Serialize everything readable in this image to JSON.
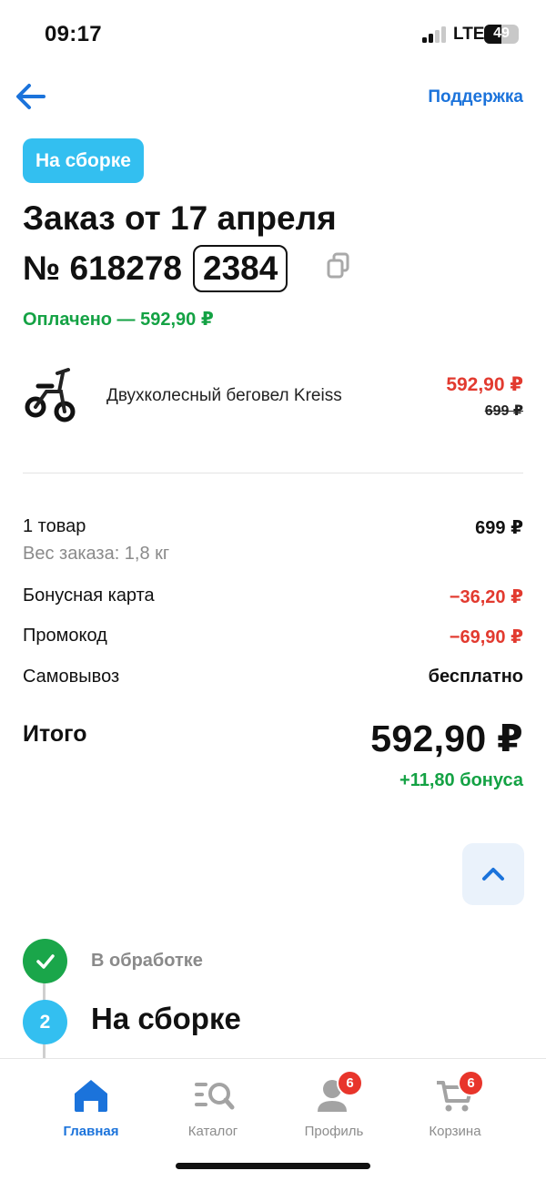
{
  "status_bar": {
    "time": "09:17",
    "network": "LTE",
    "battery": "49",
    "battery_level": 0.49
  },
  "header": {
    "support_label": "Поддержка"
  },
  "order": {
    "status_badge": "На сборке",
    "title": "Заказ от 17 апреля",
    "number_prefix": "№ 618278",
    "number_highlight": "2384",
    "paid_text": "Оплачено — 592,90 ₽"
  },
  "item": {
    "name": "Двухколесный беговел Kreiss",
    "price": "592,90 ₽",
    "old_price": "699 ₽"
  },
  "summary": {
    "items_count_label": "1 товар",
    "items_total": "699 ₽",
    "weight_label": "Вес заказа: 1,8 кг",
    "bonus_card_label": "Бонусная карта",
    "bonus_card_value": "−36,20 ₽",
    "promo_label": "Промокод",
    "promo_value": "−69,90 ₽",
    "pickup_label": "Самовывоз",
    "pickup_value": "бесплатно",
    "total_label": "Итого",
    "total_value": "592,90 ₽",
    "bonus_earned": "+11,80 бонуса"
  },
  "steps": [
    {
      "label": "В обработке",
      "state": "done"
    },
    {
      "number": "2",
      "label": "На сборке",
      "state": "current"
    }
  ],
  "tabbar": {
    "items": [
      {
        "label": "Главная",
        "icon": "home-icon",
        "active": true
      },
      {
        "label": "Каталог",
        "icon": "catalog-search-icon"
      },
      {
        "label": "Профиль",
        "icon": "profile-icon",
        "badge": "6"
      },
      {
        "label": "Корзина",
        "icon": "cart-icon",
        "badge": "6"
      }
    ]
  },
  "colors": {
    "accent_blue": "#1b73db",
    "badge_cyan": "#33bff0",
    "success_green": "#14a244",
    "price_red": "#e23a2f"
  }
}
